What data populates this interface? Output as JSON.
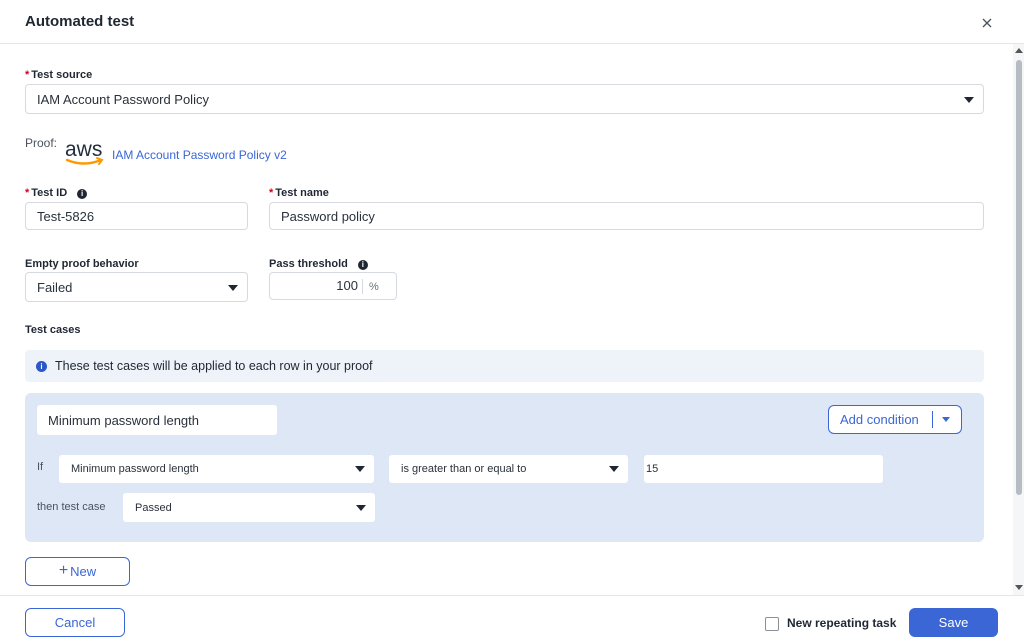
{
  "dialog": {
    "title": "Automated test"
  },
  "test_source": {
    "label": "Test source",
    "value": "IAM Account Password Policy"
  },
  "proof": {
    "label": "Proof:",
    "logo_text": "aws",
    "link": "IAM Account Password Policy v2"
  },
  "test_id": {
    "label": "Test ID",
    "value": "Test-5826"
  },
  "test_name": {
    "label": "Test name",
    "value": "Password policy"
  },
  "empty_proof": {
    "label": "Empty proof behavior",
    "value": "Failed"
  },
  "pass_threshold": {
    "label": "Pass threshold",
    "value": "100",
    "unit": "%"
  },
  "test_cases": {
    "label": "Test cases",
    "banner": "These test cases will be applied to each row in your proof",
    "case": {
      "name": "Minimum password length",
      "add_condition": "Add condition",
      "if_label": "If",
      "field": "Minimum password length",
      "operator": "is greater than or equal to",
      "value": "15",
      "then_label": "then test case",
      "result": "Passed"
    },
    "new_button": "New",
    "new_button_icon": "+"
  },
  "footer": {
    "cancel": "Cancel",
    "repeating_task": "New repeating task",
    "save": "Save"
  },
  "colors": {
    "accent": "#3a66d6",
    "required": "#d0021b",
    "case_bg": "#dde7f6",
    "banner_bg": "#eef3fa"
  }
}
